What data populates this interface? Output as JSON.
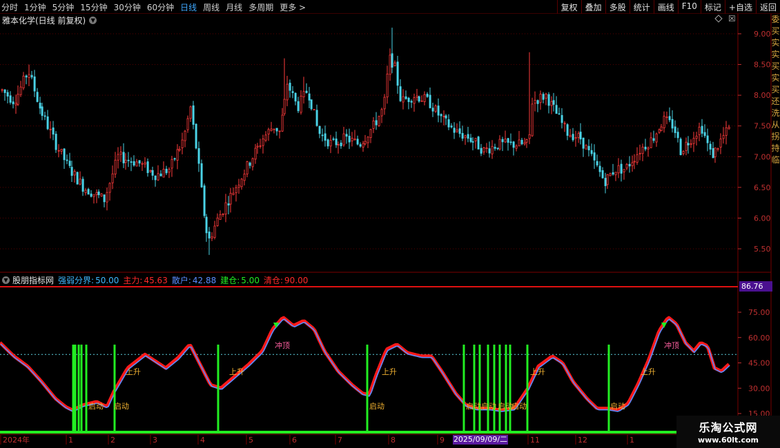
{
  "toolbar": {
    "periods": [
      {
        "label": "分时"
      },
      {
        "label": "1分钟"
      },
      {
        "label": "5分钟"
      },
      {
        "label": "15分钟"
      },
      {
        "label": "30分钟"
      },
      {
        "label": "60分钟"
      },
      {
        "label": "日线",
        "active": true
      },
      {
        "label": "周线"
      },
      {
        "label": "月线"
      },
      {
        "label": "多周期"
      },
      {
        "label": "更多 >"
      }
    ],
    "buttons": [
      {
        "label": "复权"
      },
      {
        "label": "叠加"
      },
      {
        "label": "多股"
      },
      {
        "label": "统计"
      },
      {
        "label": "画线"
      },
      {
        "label": "F10"
      },
      {
        "label": "标记"
      },
      {
        "label": "+自选"
      },
      {
        "label": "返回"
      }
    ]
  },
  "main_chart": {
    "title": "雅本化学(日线 前复权)",
    "close_symbol": "☒",
    "price_ticks": [
      "9.00",
      "8.50",
      "8.00",
      "7.50",
      "7.00",
      "6.50",
      "6.00",
      "5.50"
    ],
    "up_color": "#ff3b3b",
    "down_color": "#4ad3e6"
  },
  "indicator": {
    "name": "股朋指标网",
    "params": [
      {
        "label": "强弱分界:",
        "value": "50.00",
        "color": "#3fb8ff"
      },
      {
        "label": "主力:",
        "value": "45.63",
        "color": "#ff2a2a"
      },
      {
        "label": "散户:",
        "value": "42.88",
        "color": "#5a8cff"
      },
      {
        "label": "建仓:",
        "value": "5.00",
        "color": "#22ee22"
      },
      {
        "label": "清仓:",
        "value": "90.00",
        "color": "#ff2a2a"
      }
    ],
    "level_box": "86.76",
    "ticks": [
      "75.00",
      "60.00",
      "45.00",
      "30.00",
      "15.00"
    ],
    "signal_labels": {
      "rise": "上升",
      "top": "冲顶",
      "start": "启动"
    }
  },
  "date_axis": {
    "labels": [
      "2024年",
      "1",
      "2",
      "3",
      "4",
      "5",
      "6",
      "7",
      "8",
      "9",
      "11",
      "12",
      "1"
    ],
    "cursor_date": "2025/09/09/二"
  },
  "side_strip": {
    "chars": [
      "委",
      "买",
      "实",
      "实",
      "买",
      "实",
      "买",
      "还",
      "洗",
      "从",
      "拐",
      "持",
      "临"
    ]
  },
  "watermark": {
    "title": "乐淘公式网",
    "url": "www.60lt.com"
  }
}
